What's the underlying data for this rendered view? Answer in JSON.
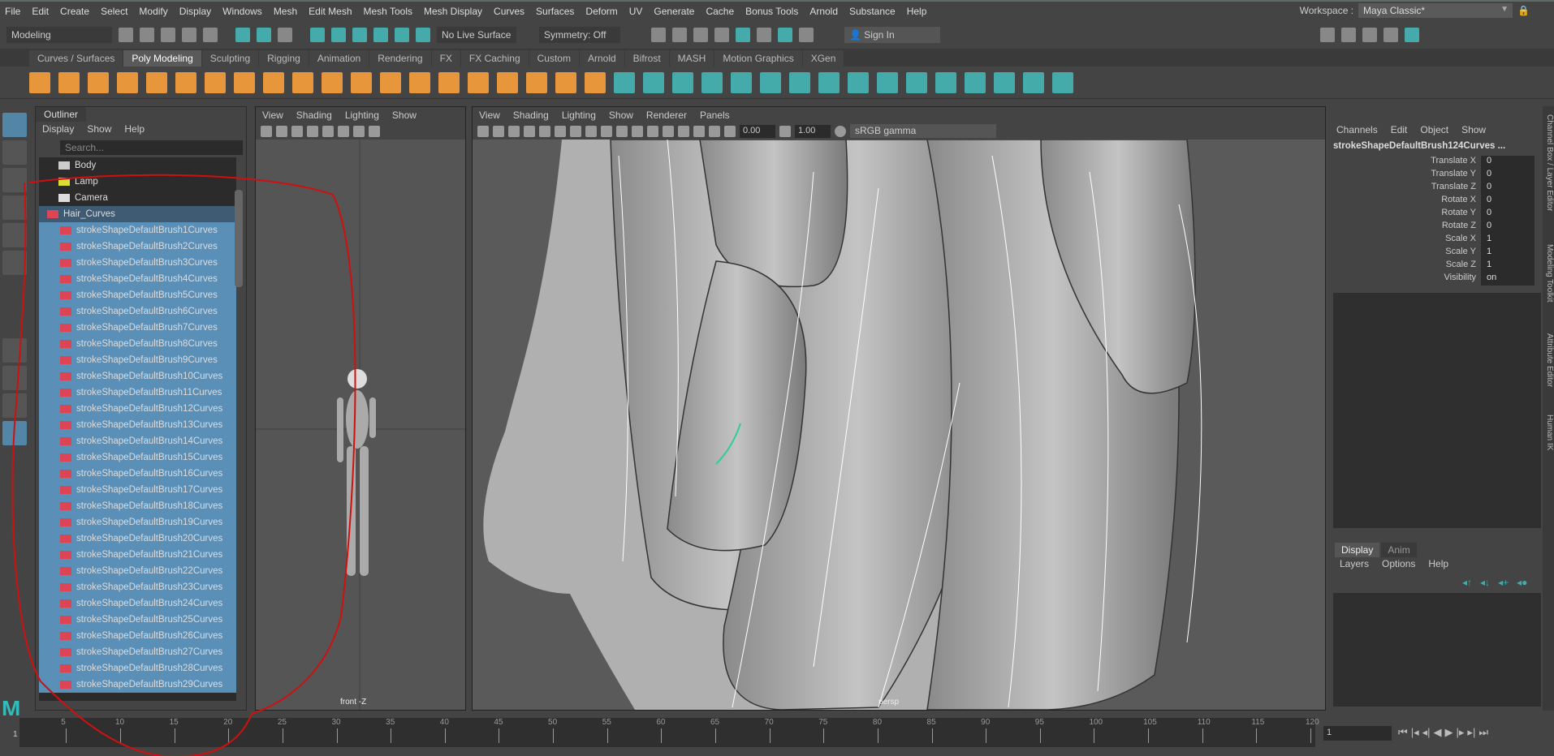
{
  "menubar": {
    "items": [
      "File",
      "Edit",
      "Create",
      "Select",
      "Modify",
      "Display",
      "Windows",
      "Mesh",
      "Edit Mesh",
      "Mesh Tools",
      "Mesh Display",
      "Curves",
      "Surfaces",
      "Deform",
      "UV",
      "Generate",
      "Cache",
      "Bonus Tools",
      "Arnold",
      "Substance",
      "Help"
    ],
    "workspace_label": "Workspace :",
    "workspace_value": "Maya Classic*"
  },
  "status": {
    "mode": "Modeling",
    "live_surface": "No Live Surface",
    "symmetry": "Symmetry: Off",
    "sign_in": "Sign In"
  },
  "shelf": {
    "tabs": [
      "Curves / Surfaces",
      "Poly Modeling",
      "Sculpting",
      "Rigging",
      "Animation",
      "Rendering",
      "FX",
      "FX Caching",
      "Custom",
      "Arnold",
      "Bifrost",
      "MASH",
      "Motion Graphics",
      "XGen"
    ],
    "active": "Poly Modeling"
  },
  "outliner": {
    "tab": "Outliner",
    "menu": [
      "Display",
      "Show",
      "Help"
    ],
    "search_placeholder": "Search...",
    "items": [
      {
        "label": "Body",
        "type": "mesh"
      },
      {
        "label": "Lamp",
        "type": "light"
      },
      {
        "label": "Camera",
        "type": "camera"
      },
      {
        "label": "Hair_Curves",
        "type": "group"
      },
      {
        "label": "strokeShapeDefaultBrush1Curves"
      },
      {
        "label": "strokeShapeDefaultBrush2Curves"
      },
      {
        "label": "strokeShapeDefaultBrush3Curves"
      },
      {
        "label": "strokeShapeDefaultBrush4Curves"
      },
      {
        "label": "strokeShapeDefaultBrush5Curves"
      },
      {
        "label": "strokeShapeDefaultBrush6Curves"
      },
      {
        "label": "strokeShapeDefaultBrush7Curves"
      },
      {
        "label": "strokeShapeDefaultBrush8Curves"
      },
      {
        "label": "strokeShapeDefaultBrush9Curves"
      },
      {
        "label": "strokeShapeDefaultBrush10Curves"
      },
      {
        "label": "strokeShapeDefaultBrush11Curves"
      },
      {
        "label": "strokeShapeDefaultBrush12Curves"
      },
      {
        "label": "strokeShapeDefaultBrush13Curves"
      },
      {
        "label": "strokeShapeDefaultBrush14Curves"
      },
      {
        "label": "strokeShapeDefaultBrush15Curves"
      },
      {
        "label": "strokeShapeDefaultBrush16Curves"
      },
      {
        "label": "strokeShapeDefaultBrush17Curves"
      },
      {
        "label": "strokeShapeDefaultBrush18Curves"
      },
      {
        "label": "strokeShapeDefaultBrush19Curves"
      },
      {
        "label": "strokeShapeDefaultBrush20Curves"
      },
      {
        "label": "strokeShapeDefaultBrush21Curves"
      },
      {
        "label": "strokeShapeDefaultBrush22Curves"
      },
      {
        "label": "strokeShapeDefaultBrush23Curves"
      },
      {
        "label": "strokeShapeDefaultBrush24Curves"
      },
      {
        "label": "strokeShapeDefaultBrush25Curves"
      },
      {
        "label": "strokeShapeDefaultBrush26Curves"
      },
      {
        "label": "strokeShapeDefaultBrush27Curves"
      },
      {
        "label": "strokeShapeDefaultBrush28Curves"
      },
      {
        "label": "strokeShapeDefaultBrush29Curves"
      }
    ]
  },
  "front_view": {
    "menu": [
      "View",
      "Shading",
      "Lighting",
      "Show"
    ],
    "label": "front -Z"
  },
  "persp_view": {
    "menu": [
      "View",
      "Shading",
      "Lighting",
      "Show",
      "Renderer",
      "Panels"
    ],
    "label": "persp",
    "exposure": "0.00",
    "gamma": "1.00",
    "color_space": "sRGB gamma"
  },
  "channel_box": {
    "menu": [
      "Channels",
      "Edit",
      "Object",
      "Show"
    ],
    "object": "strokeShapeDefaultBrush124Curves ...",
    "channels": [
      {
        "name": "Translate X",
        "value": "0"
      },
      {
        "name": "Translate Y",
        "value": "0"
      },
      {
        "name": "Translate Z",
        "value": "0"
      },
      {
        "name": "Rotate X",
        "value": "0"
      },
      {
        "name": "Rotate Y",
        "value": "0"
      },
      {
        "name": "Rotate Z",
        "value": "0"
      },
      {
        "name": "Scale X",
        "value": "1"
      },
      {
        "name": "Scale Y",
        "value": "1"
      },
      {
        "name": "Scale Z",
        "value": "1"
      },
      {
        "name": "Visibility",
        "value": "on"
      }
    ]
  },
  "layer_editor": {
    "tabs": [
      "Display",
      "Anim"
    ],
    "menu": [
      "Layers",
      "Options",
      "Help"
    ]
  },
  "side_tabs": [
    "Channel Box / Layer Editor",
    "Modeling Toolkit",
    "Attribute Editor",
    "Human IK"
  ],
  "timeline": {
    "ticks": [
      5,
      10,
      15,
      20,
      25,
      30,
      35,
      40,
      45,
      50,
      55,
      60,
      65,
      70,
      75,
      80,
      85,
      90,
      95,
      100,
      105,
      110,
      115,
      120
    ],
    "start": "1",
    "current_frame": "1"
  },
  "colors": {
    "selection": "#5a8fb8",
    "accent": "#4aa",
    "annotation": "#d01010"
  }
}
